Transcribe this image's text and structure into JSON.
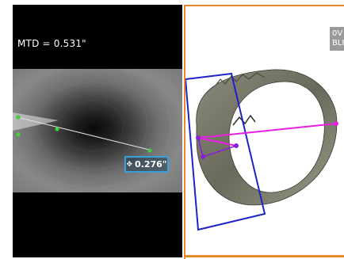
{
  "measurement": {
    "mtd_text": "MTD = 0.531\"",
    "value_text": "0.276\"",
    "badge_icon": "cursor-move-icon"
  },
  "point_cloud": {
    "corner_line1": "0V",
    "corner_line2": "BLI"
  },
  "colors": {
    "plane_outline": "#1e22c8",
    "depth_line": "#e81fe0",
    "panel_border": "#e8892e",
    "cursor_dot": "#3bd23b",
    "badge_border": "#3aa0d8"
  }
}
